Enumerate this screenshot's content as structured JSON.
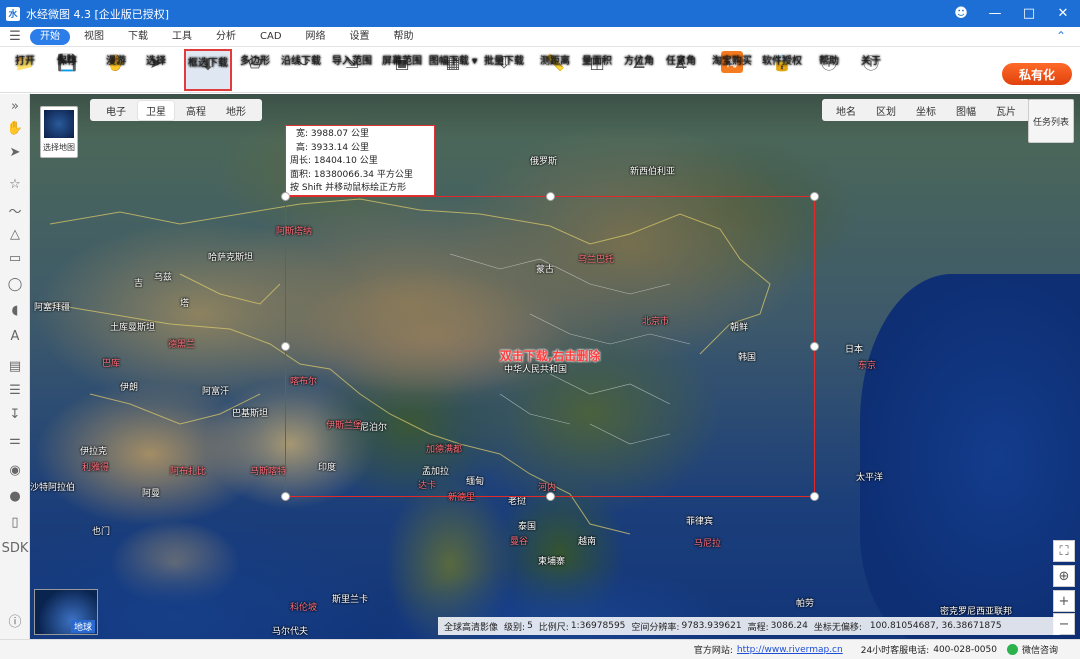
{
  "window": {
    "title": "水经微图 4.3 [企业版已授权]"
  },
  "menu": {
    "items": [
      "开始",
      "视图",
      "下载",
      "工具",
      "分析",
      "CAD",
      "网络",
      "设置",
      "帮助"
    ],
    "active": "开始"
  },
  "toolbar": {
    "open": "打开",
    "save": "保存",
    "roam": "漫游",
    "select": "选择",
    "box_download": "框选下载",
    "polygon": "多边形",
    "along_line": "沿线下载",
    "import_range": "导入范围",
    "screen_range": "屏幕范围",
    "sheet_download": "图幅下载",
    "batch_download": "批量下载",
    "measure_distance": "测距离",
    "measure_area": "量面积",
    "azimuth": "方位角",
    "arbitrary_angle": "任意角",
    "taobao": "淘宝购买",
    "license": "软件授权",
    "help": "帮助",
    "about": "关于",
    "taobao_icon_text": "淘",
    "private_button": "私有化"
  },
  "map_selector": {
    "label": "选择地图"
  },
  "map_types": [
    "电子",
    "卫星",
    "高程",
    "地形"
  ],
  "map_type_active": "卫星",
  "overlays": [
    "地名",
    "区划",
    "坐标",
    "图幅",
    "瓦片"
  ],
  "task_list": "任务列表",
  "selection_info": {
    "width": "宽:  3988.07 公里",
    "height": "高:  3933.14 公里",
    "perimeter": "周长: 18404.10 公里",
    "area": "面积: 18380066.34 平方公里",
    "hint": "按 Shift 并移动鼠标绘正方形"
  },
  "selection_hint": "双击下载,右击删除",
  "map_labels": {
    "russia": "俄罗斯",
    "mongolia": "蒙古",
    "kazakhstan": "哈萨克斯坦",
    "china": "中华人民共和国",
    "north_korea": "朝鲜",
    "south_korea": "韩国",
    "japan": "日本",
    "tokyo": "东京",
    "beijing": "北京市",
    "ulaanbaatar": "乌兰巴托",
    "astana": "阿斯塔纳",
    "iran": "伊朗",
    "turkmenistan": "土库曼斯坦",
    "afghanistan": "阿富汗",
    "pakistan": "巴基斯坦",
    "india": "印度",
    "nepal": "尼泊尔",
    "bangladesh": "孟加拉",
    "myanmar": "缅甸",
    "thailand": "泰国",
    "laos": "老挝",
    "vietnam": "越南",
    "cambodia": "柬埔寨",
    "philippines": "菲律宾",
    "manila": "马尼拉",
    "hanoi": "河内",
    "bangkok": "曼谷",
    "new_delhi": "新德里",
    "kabul": "喀布尔",
    "islamabad": "伊斯兰堡",
    "tehran": "德黑兰",
    "kathmandu": "加德满都",
    "dhaka": "达卡",
    "saudi": "沙特阿拉伯",
    "oman": "阿曼",
    "iraq": "伊拉克",
    "riyadh": "利雅得",
    "abu_dhabi": "阿布扎比",
    "muscat": "马斯喀特",
    "yemen": "也门",
    "sri_lanka": "斯里兰卡",
    "maldives": "马尔代夫",
    "colombo": "科伦坡",
    "palau": "帕劳",
    "micronesia": "密克罗尼西亚联邦",
    "pacific": "太平洋",
    "novosibirsk": "新西伯利亚",
    "kyrgyzstan": "吉",
    "tajikistan": "塔",
    "uzbekistan": "乌兹",
    "azerbaijan": "阿塞拜疆",
    "baku": "巴库"
  },
  "globe_label": "地球",
  "status": {
    "source": "全球高清影像",
    "level": "级别:",
    "level_value": "5",
    "scale": "比例尺:",
    "scale_value": "1:36978595",
    "resolution": "空间分辨率:",
    "resolution_value": "9783.939621",
    "elevation": "高程:",
    "elevation_value": "3086.24",
    "coord_no_offset": "坐标无偏移:",
    "coords": "100.81054687, 36.38671875"
  },
  "footer": {
    "website_label": "官方网站:",
    "website_url": "http://www.rivermap.cn",
    "hotline_label": "24小时客服电话:",
    "hotline": "400-028-0050",
    "wechat": "微信咨询"
  },
  "colors": {
    "titlebar": "#1d6fd6",
    "accent": "#2b7de9",
    "selection": "#e02a2a",
    "private_button": "#ef5a1a"
  }
}
